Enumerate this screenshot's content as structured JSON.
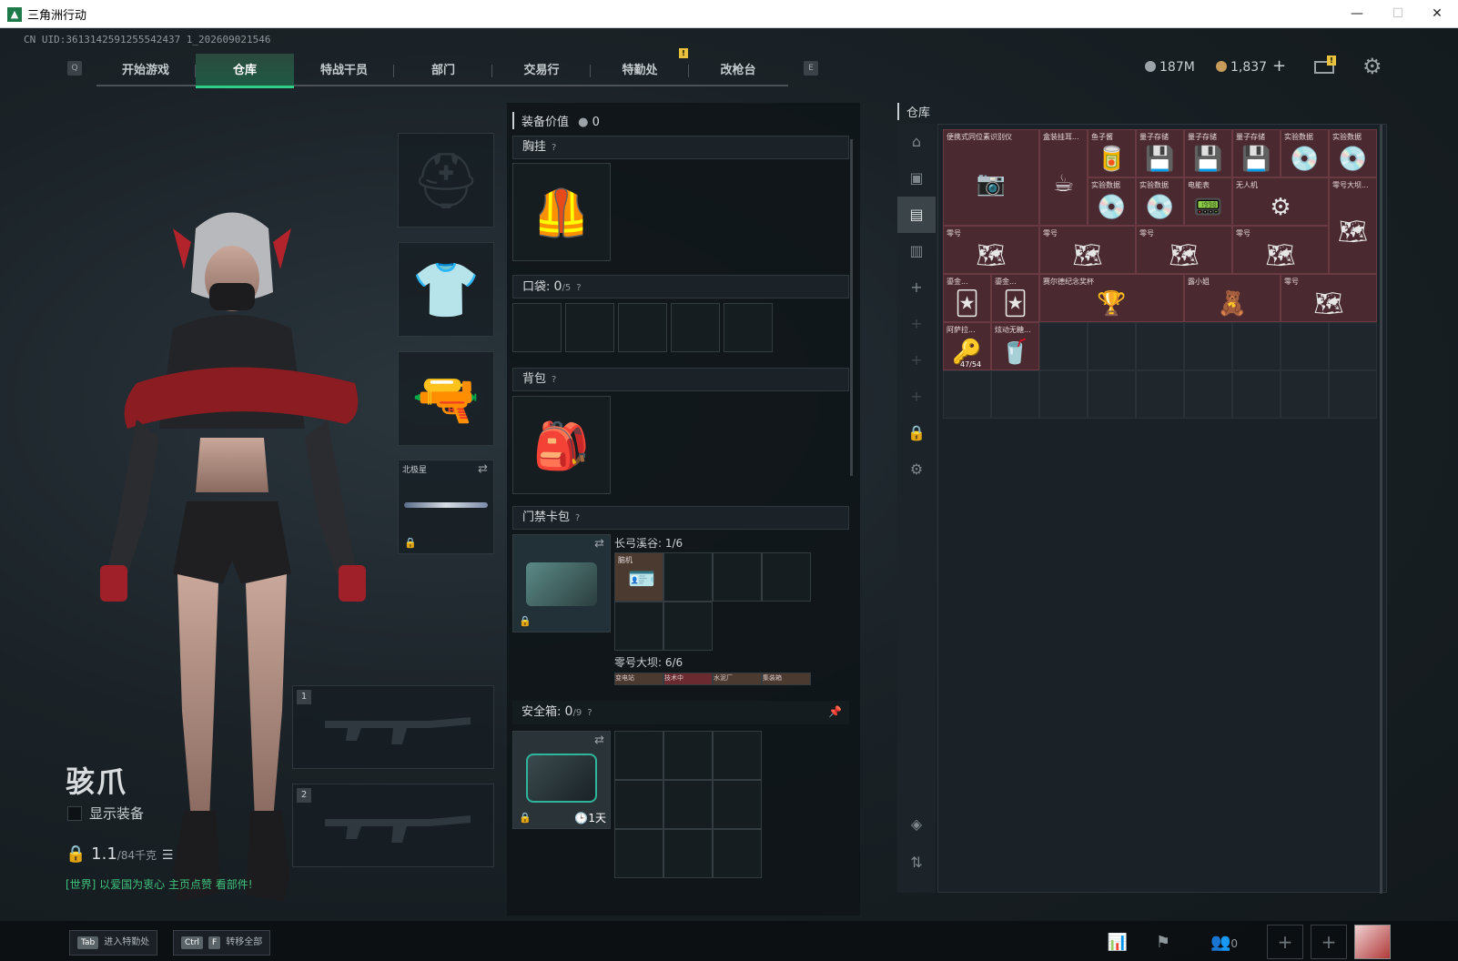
{
  "window": {
    "title": "三角洲行动",
    "minimize": "—",
    "maximize": "☐",
    "close": "✕"
  },
  "uid": "CN UID:3613142591255542437 1_202609021546",
  "nav": {
    "key_left": "Q",
    "key_right": "E",
    "tabs": [
      "开始游戏",
      "仓库",
      "特战干员",
      "部门",
      "交易行",
      "特勤处",
      "改枪台"
    ],
    "active_tab": 1,
    "badge": "!"
  },
  "currency": {
    "silver": "187M",
    "gold": "1,837",
    "plus": "+",
    "mail_badge": "!"
  },
  "character": {
    "name": "骇爪",
    "show_equipment": "显示装备",
    "weight": "1.1",
    "weight_max": "/84千克",
    "chat": "[世界] 以爱国为衷心 主页点赞 看部件!"
  },
  "gear": {
    "melee_label": "北极星",
    "slot1": "1",
    "slot2": "2"
  },
  "loadout": {
    "equip_value_label": "装备价值",
    "equip_value": "0",
    "chest": "胸挂",
    "pocket": "口袋:",
    "pocket_count": "0",
    "pocket_max": "/5",
    "backpack": "背包",
    "keycard": "门禁卡包",
    "keycard_group1": "长弓溪谷: 1/6",
    "keycard_group2": "零号大坝: 6/6",
    "keycard_item": "脑机",
    "keycard_mini": [
      "变电站",
      "技术中",
      "水泥厂",
      "集装箱"
    ],
    "safe": "安全箱:",
    "safe_count": "0",
    "safe_max": "/9",
    "safe_timer": "1天",
    "q": "?"
  },
  "storage": {
    "title": "仓库",
    "items": [
      {
        "label": "便携式同位素识别仪",
        "icon": "📷"
      },
      {
        "label": "盒装挂耳...",
        "icon": "☕"
      },
      {
        "label": "鱼子酱",
        "icon": "🥫"
      },
      {
        "label": "量子存储",
        "icon": "💾"
      },
      {
        "label": "量子存储",
        "icon": "💾"
      },
      {
        "label": "量子存储",
        "icon": "💾"
      },
      {
        "label": "实验数据",
        "icon": "💿"
      },
      {
        "label": "实验数据",
        "icon": "💿"
      },
      {
        "label": "实验数据",
        "icon": "💿"
      },
      {
        "label": "实验数据",
        "icon": "💿"
      },
      {
        "label": "电能表",
        "icon": "📟"
      },
      {
        "label": "无人机",
        "icon": "⚙"
      },
      {
        "label": "零号大坝...",
        "icon": "🗺"
      },
      {
        "label": "零号",
        "icon": "🗺"
      },
      {
        "label": "零号",
        "icon": "🗺"
      },
      {
        "label": "零号",
        "icon": "🗺"
      },
      {
        "label": "零号",
        "icon": "🗺"
      },
      {
        "label": "鎏金...",
        "icon": "🃏"
      },
      {
        "label": "鎏金...",
        "icon": "🃏"
      },
      {
        "label": "赛尔德纪念奖杯",
        "icon": "🏆"
      },
      {
        "label": "露小姐",
        "icon": "🧸"
      },
      {
        "label": "零号",
        "icon": "🗺"
      },
      {
        "label": "阿萨拉...",
        "icon": "🔑"
      },
      {
        "label": "炫动无糖...",
        "icon": "🥤"
      }
    ],
    "ammo_count": "47/54"
  },
  "bottom": {
    "tab_key": "Tab",
    "tab_label": "进入特勤处",
    "ctrl_key": "Ctrl",
    "f_key": "F",
    "transfer_label": "转移全部",
    "friends_count": "0",
    "plus": "+"
  }
}
